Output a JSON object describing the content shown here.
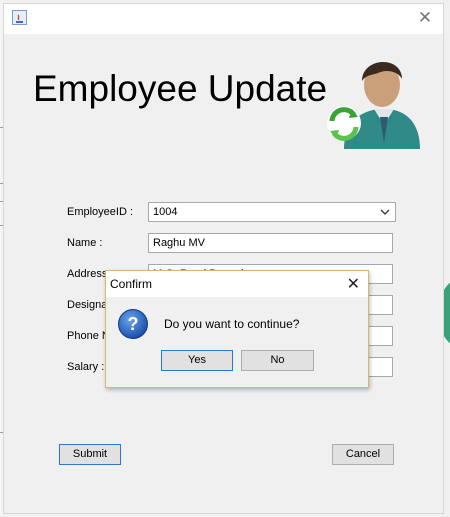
{
  "background_window": {},
  "window": {
    "close_glyph": "✕",
    "heading": "Employee Update",
    "avatar_icon": "employee-refresh-icon"
  },
  "form": {
    "employee_id": {
      "label": "EmployeeID :",
      "value": "1004"
    },
    "name": {
      "label": "Name :",
      "value": "Raghu MV"
    },
    "address": {
      "label": "Address",
      "value": "M.G. Road Bangalore"
    },
    "designation": {
      "label": "Designa"
    },
    "phone": {
      "label": "Phone N"
    },
    "salary": {
      "label": "Salary :"
    },
    "submit_label": "Submit",
    "cancel_label": "Cancel"
  },
  "dialog": {
    "title": "Confirm",
    "close_glyph": "✕",
    "message": "Do you want to continue?",
    "icon": "question-icon",
    "yes_label": "Yes",
    "no_label": "No"
  },
  "colors": {
    "accent_blue": "#2a78d0",
    "dialog_border": "#d7b57a",
    "avatar_green": "#3aa17b"
  }
}
